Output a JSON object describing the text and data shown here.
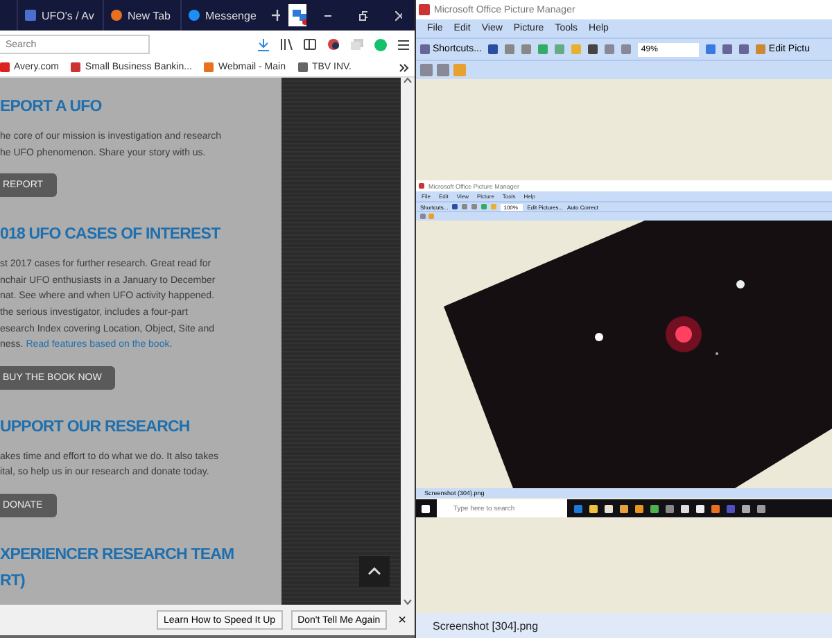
{
  "browser": {
    "tabs": [
      {
        "label": "UFO's / Av"
      },
      {
        "label": "New Tab"
      },
      {
        "label": "Messenge"
      }
    ],
    "search": {
      "placeholder": "Search"
    },
    "bookmarks": [
      {
        "label": "Avery.com"
      },
      {
        "label": "Small Business Bankin..."
      },
      {
        "label": "Webmail - Main"
      },
      {
        "label": "TBV INV."
      }
    ],
    "sections": [
      {
        "heading": [
          "EPORT A UFO"
        ],
        "lines": [
          "he core of our mission is investigation and research",
          "he UFO phenomenon. Share your story with us."
        ],
        "button": "REPORT"
      },
      {
        "heading": [
          "018 UFO CASES OF INTEREST"
        ],
        "lines": [
          "st 2017 cases for further research. Great read for",
          "nchair UFO enthusiasts in a January to December",
          "nat. See where and when UFO activity happened.",
          "the serious investigator, includes a four-part",
          "esearch Index covering Location, Object, Site and"
        ],
        "last_line": {
          "text": "ness. ",
          "link": "Read features based on the book",
          "after": "."
        },
        "button": "BUY THE BOOK NOW"
      },
      {
        "heading": [
          "UPPORT OUR RESEARCH"
        ],
        "lines": [
          "akes time and effort to do what we do. It also takes",
          "ital, so help us in our research and donate today."
        ],
        "button": "DONATE"
      },
      {
        "heading": [
          "XPERIENCER RESEARCH TEAM",
          "RT)"
        ]
      }
    ],
    "notification": {
      "buttons": [
        "Learn How to Speed It Up",
        "Don't Tell Me Again"
      ],
      "close": "×"
    }
  },
  "picture_manager": {
    "title": "Microsoft Office Picture Manager",
    "menu": [
      "File",
      "Edit",
      "View",
      "Picture",
      "Tools",
      "Help"
    ],
    "toolbar": {
      "shortcuts": "Shortcuts...",
      "zoom": "49%",
      "edit": "Edit Pictu"
    },
    "preview": {
      "title": "Microsoft Office Picture Manager",
      "menu": [
        "File",
        "Edit",
        "View",
        "Picture",
        "Tools",
        "Help"
      ],
      "shortcuts": "Shortcuts...",
      "zoom": "100%",
      "edit": "Edit Pictures...",
      "auto": "Auto Correct",
      "file": "Screenshot (304).png",
      "taskbar_search": {
        "placeholder": "Type here to search"
      }
    },
    "status": "Screenshot [304].png"
  }
}
